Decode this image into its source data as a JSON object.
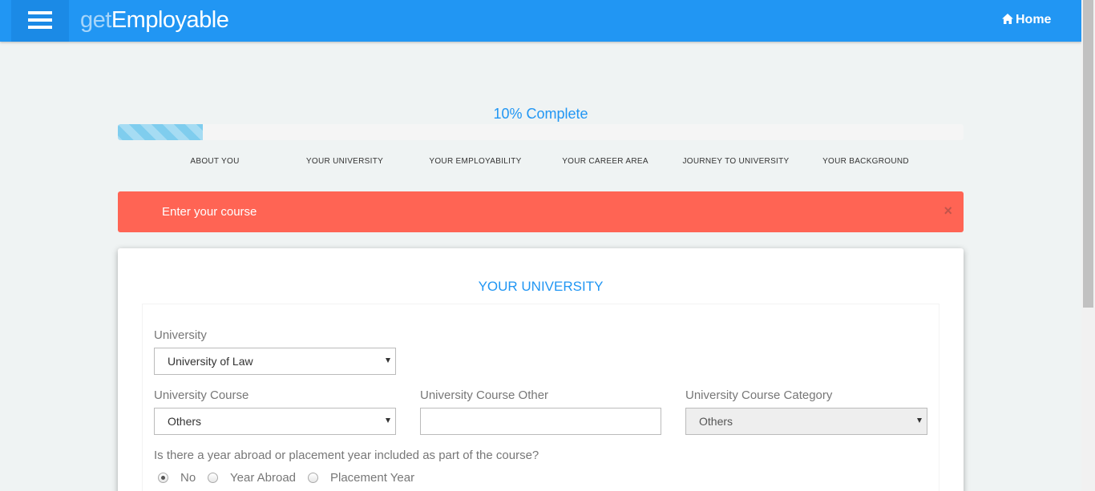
{
  "header": {
    "brand_prefix": "get",
    "brand_main": "Employable",
    "home_label": "Home",
    "accent_color": "#2196f3",
    "menu_icon": "hamburger-menu-icon",
    "home_icon": "home-icon"
  },
  "progress": {
    "label": "10% Complete",
    "percent": 10
  },
  "steps": [
    "ABOUT YOU",
    "YOUR UNIVERSITY",
    "YOUR EMPLOYABILITY",
    "YOUR CAREER AREA",
    "JOURNEY TO UNIVERSITY",
    "YOUR BACKGROUND"
  ],
  "alert": {
    "message": "Enter your course",
    "close_symbol": "×",
    "color": "#ff6454"
  },
  "section": {
    "title": "YOUR UNIVERSITY",
    "university": {
      "label": "University",
      "value": "University of Law"
    },
    "course": {
      "label": "University Course",
      "value": "Others"
    },
    "course_other": {
      "label": "University Course Other",
      "value": ""
    },
    "course_category": {
      "label": "University Course Category",
      "value": "Others"
    },
    "year_abroad": {
      "question": "Is there a year abroad or placement year included as part of the course?",
      "options": [
        "No",
        "Year Abroad",
        "Placement Year"
      ],
      "selected": "No"
    }
  }
}
